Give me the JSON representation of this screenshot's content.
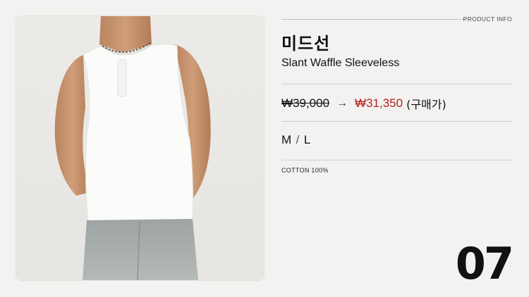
{
  "header": {
    "section_label": "PRODUCT INFO"
  },
  "product": {
    "brand": "미드선",
    "name": "Slant Waffle Sleeveless",
    "price_original": "₩39,000",
    "price_sale": "₩31,350",
    "price_note": "(구매가)",
    "sizes": [
      "M",
      "L"
    ],
    "material": "COTTON 100%"
  },
  "index_number": "07",
  "colors": {
    "sale_price": "#b22222",
    "background": "#f3f2f0"
  }
}
